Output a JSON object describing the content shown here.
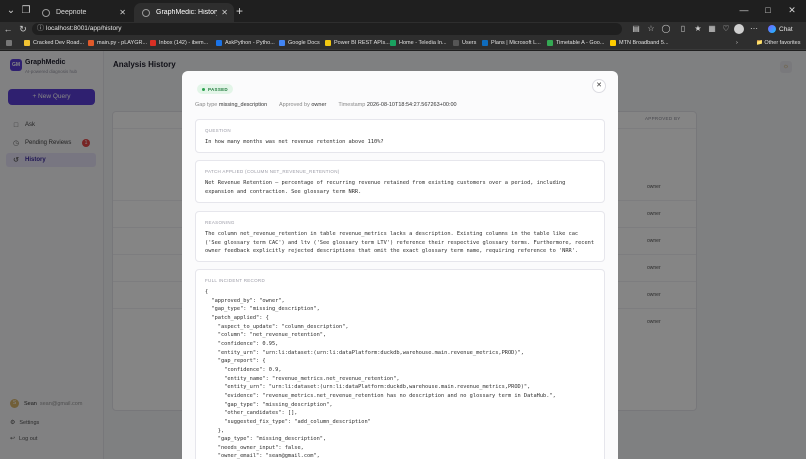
{
  "browser": {
    "tabs": [
      {
        "label": "Deepnote",
        "active": false
      },
      {
        "label": "GraphMedic: History",
        "active": true
      }
    ],
    "url": "localhost:8001/app/history",
    "chat_label": "Chat",
    "bookmarks": [
      {
        "label": "Cracked Dev Road...",
        "color": "#f1c232"
      },
      {
        "label": "main.py - pLAYGR...",
        "color": "#e05a2a"
      },
      {
        "label": "Inbox (142) - ibem...",
        "color": "#d93025"
      },
      {
        "label": "AskPython - Pytho...",
        "color": "#1a73e8"
      },
      {
        "label": "Google Docs",
        "color": "#4285f4"
      },
      {
        "label": "Power BI REST APIs...",
        "color": "#f2c811"
      },
      {
        "label": "Home - Teledia In...",
        "color": "#1aa260"
      },
      {
        "label": "Users",
        "color": "#555555"
      },
      {
        "label": "Plans | Microsoft L...",
        "color": "#0f6cbd"
      },
      {
        "label": "Timetable A - Goo...",
        "color": "#34a853"
      },
      {
        "label": "MTN Broadband 5...",
        "color": "#ffcc00"
      }
    ],
    "other_favorites": "Other favorites"
  },
  "sidebar": {
    "logo_text": "GM",
    "brand": "GraphMedic",
    "tagline": "AI-powered diagnosis hub",
    "new_query": "+ New Query",
    "items": [
      {
        "label": "Ask",
        "icon": "chat-icon",
        "glyph": "□"
      },
      {
        "label": "Pending Reviews",
        "icon": "clock-icon",
        "glyph": "◷",
        "badge": "1"
      },
      {
        "label": "History",
        "icon": "history-icon",
        "glyph": "↺",
        "active": true
      }
    ],
    "user": {
      "initial": "S",
      "name": "Sean",
      "email": "sean@gmail.com"
    },
    "settings": "Settings",
    "logout": "Log out"
  },
  "main": {
    "title": "Analysis History",
    "table_header_approved_by": "APPROVED BY",
    "table_rows_approved_by": [
      "owner",
      "owner",
      "owner",
      "owner",
      "owner",
      "owner"
    ]
  },
  "modal": {
    "status": "PASSED",
    "meta": {
      "gap_type_label": "Gap type",
      "gap_type_value": "missing_description",
      "approved_by_label": "Approved by",
      "approved_by_value": "owner",
      "timestamp_label": "Timestamp",
      "timestamp_value": "2026-08-10T18:54:27.567263+00:00"
    },
    "question": {
      "label": "QUESTION",
      "text": "In how many months was net revenue retention above 110%?"
    },
    "patch": {
      "label": "PATCH APPLIED (COLUMN NET_REVENUE_RETENTION)",
      "text": "Net Revenue Retention — percentage of recurring revenue retained from existing customers over a period, including expansion and contraction. See glossary term NRR."
    },
    "reasoning": {
      "label": "REASONING",
      "text": "The column net_revenue_retention in table revenue_metrics lacks a description. Existing columns in the table like cac ('See glossary term CAC') and ltv ('See glossary term LTV') reference their respective glossary terms. Furthermore, recent owner feedback explicitly rejected descriptions that omit the exact glossary term name, requiring reference to 'NRR'."
    },
    "record": {
      "label": "FULL INCIDENT RECORD",
      "json": "{\n  \"approved_by\": \"owner\",\n  \"gap_type\": \"missing_description\",\n  \"patch_applied\": {\n    \"aspect_to_update\": \"column_description\",\n    \"column\": \"net_revenue_retention\",\n    \"confidence\": 0.95,\n    \"entity_urn\": \"urn:li:dataset:(urn:li:dataPlatform:duckdb,warehouse.main.revenue_metrics,PROD)\",\n    \"gap_report\": {\n      \"confidence\": 0.9,\n      \"entity_name\": \"revenue_metrics.net_revenue_retention\",\n      \"entity_urn\": \"urn:li:dataset:(urn:li:dataPlatform:duckdb,warehouse.main.revenue_metrics,PROD)\",\n      \"evidence\": \"revenue_metrics.net_revenue_retention has no description and no glossary term in DataHub.\",\n      \"gap_type\": \"missing_description\",\n      \"other_candidates\": [],\n      \"suggested_fix_type\": \"add_column_description\"\n    },\n    \"gap_type\": \"missing_description\",\n    \"needs_owner_input\": false,\n    \"owner_email\": \"sean@gmail.com\","
    }
  }
}
